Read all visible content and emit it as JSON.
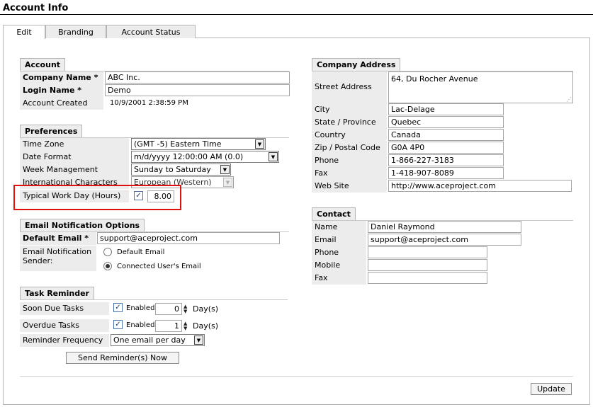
{
  "page_title": "Account Info",
  "tabs": [
    "Edit",
    "Branding",
    "Account Status"
  ],
  "account": {
    "header": "Account",
    "company_name_label": "Company Name *",
    "company_name": "ABC Inc.",
    "login_name_label": "Login Name *",
    "login_name": "Demo",
    "created_label": "Account Created",
    "created": "10/9/2001 2:38:59 PM"
  },
  "preferences": {
    "header": "Preferences",
    "time_zone_label": "Time Zone",
    "time_zone": "(GMT -5) Eastern Time",
    "date_format_label": "Date Format",
    "date_format": "m/d/yyyy 12:00:00 AM (0.0)",
    "week_label": "Week Management",
    "week": "Sunday to Saturday",
    "intl_label": "International Characters",
    "intl": "European (Western)",
    "workday_label": "Typical Work Day (Hours)",
    "workday": "8.00"
  },
  "email": {
    "header": "Email Notification Options",
    "default_label": "Default Email *",
    "default_value": "support@aceproject.com",
    "sender_label_1": "Email Notification",
    "sender_label_2": "Sender:",
    "opt_default": "Default Email",
    "opt_connected": "Connected User's Email"
  },
  "reminder": {
    "header": "Task Reminder",
    "soon_label": "Soon Due Tasks",
    "overdue_label": "Overdue Tasks",
    "enabled": "Enabled",
    "soon_days": "0",
    "overdue_days": "1",
    "days_unit": "Day(s)",
    "freq_label": "Reminder Frequency",
    "freq": "One email per day",
    "send_button": "Send Reminder(s) Now"
  },
  "address": {
    "header": "Company Address",
    "street_label": "Street Address",
    "street": "64, Du Rocher Avenue",
    "city_label": "City",
    "city": "Lac-Delage",
    "state_label": "State / Province",
    "state": "Quebec",
    "country_label": "Country",
    "country": "Canada",
    "zip_label": "Zip / Postal Code",
    "zip": "G0A 4P0",
    "phone_label": "Phone",
    "phone": "1-866-227-3183",
    "fax_label": "Fax",
    "fax": "1-418-907-8089",
    "web_label": "Web Site",
    "web": "http://www.aceproject.com"
  },
  "contact": {
    "header": "Contact",
    "name_label": "Name",
    "name": "Daniel Raymond",
    "email_label": "Email",
    "email": "support@aceproject.com",
    "phone_label": "Phone",
    "phone": "",
    "mobile_label": "Mobile",
    "mobile": "",
    "fax_label": "Fax",
    "fax": ""
  },
  "update_button": "Update",
  "colors": {
    "highlight_box": "#e01010",
    "label_bg": "#ececec",
    "checkbox": "#1d3f75"
  }
}
